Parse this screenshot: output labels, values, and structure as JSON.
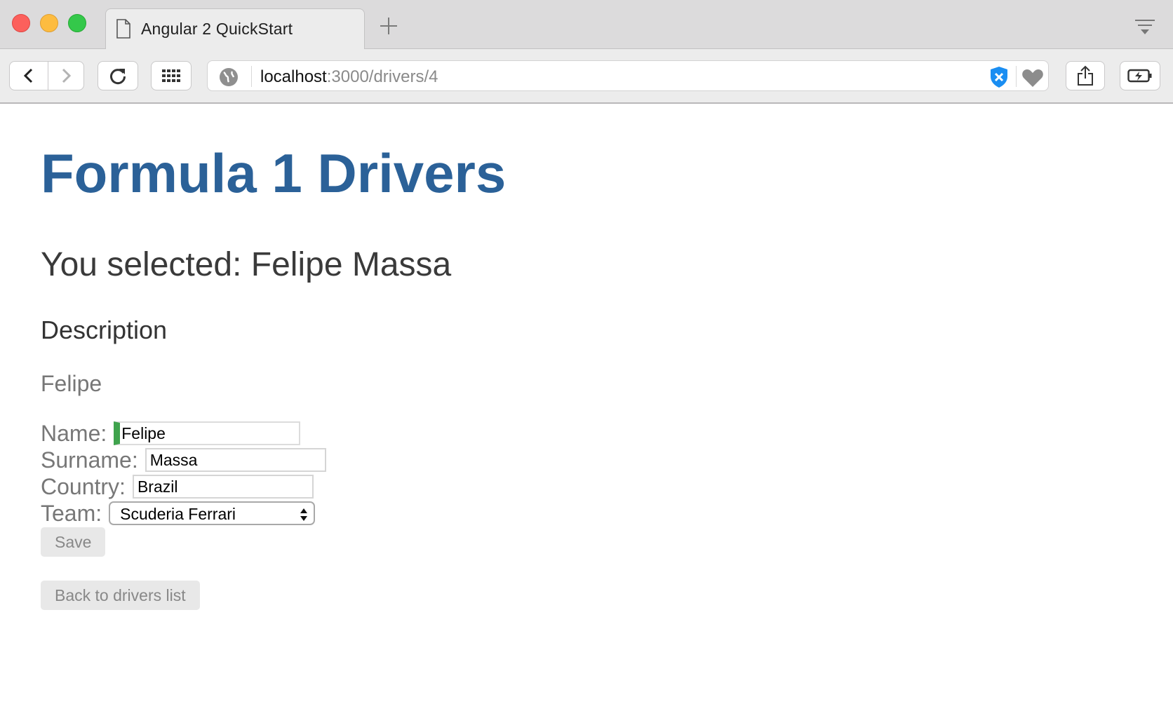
{
  "browser": {
    "tab_title": "Angular 2 QuickStart",
    "url_host": "localhost",
    "url_path": ":3000/drivers/4",
    "icons": {
      "tab": "document-icon",
      "new_tab": "plus-icon",
      "tab_overview": "tab-overview-icon",
      "back": "chevron-left-icon",
      "forward": "chevron-right-icon",
      "reload": "reload-icon",
      "apps": "grid-icon",
      "site": "globe-icon",
      "extension": "shield-icon",
      "favorite": "heart-icon",
      "share": "share-icon",
      "battery": "battery-icon"
    }
  },
  "page": {
    "title": "Formula 1 Drivers",
    "selected_text": "You selected: Felipe Massa",
    "description_heading": "Description",
    "first_name": "Felipe",
    "form": {
      "name_label": "Name:",
      "name_value": "Felipe",
      "surname_label": "Surname:",
      "surname_value": "Massa",
      "country_label": "Country:",
      "country_value": "Brazil",
      "team_label": "Team:",
      "team_value": "Scuderia Ferrari"
    },
    "save_label": "Save",
    "back_label": "Back to drivers list",
    "colors": {
      "title": "#2b6198",
      "focus_accent": "#3fa34d",
      "shield": "#1a8ef2"
    }
  }
}
